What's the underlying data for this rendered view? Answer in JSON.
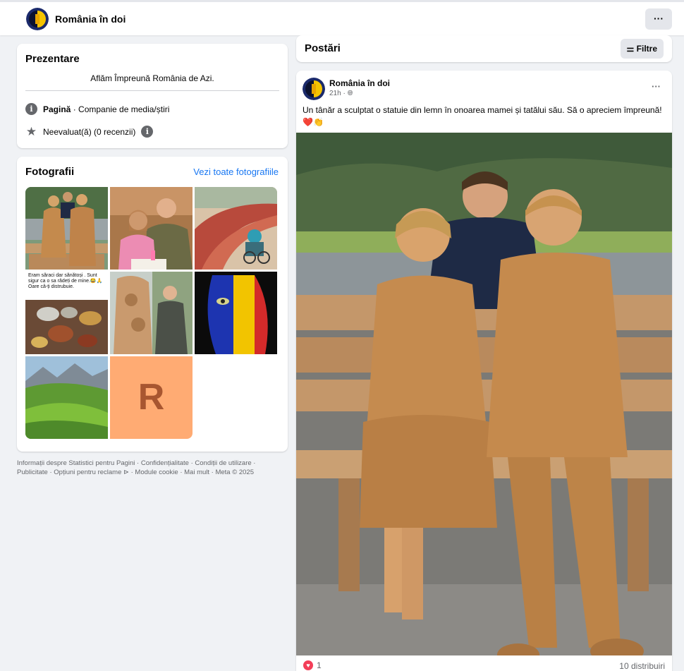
{
  "page": {
    "name": "România în doi",
    "more_label": "···"
  },
  "intro": {
    "title": "Prezentare",
    "bio": "Aflăm Împreună România de Azi.",
    "category_label": "Pagină",
    "category_value": " · Companie de media/știri",
    "rating": "Neevaluat(ă) (0 recenzii)",
    "info_icon": "info-icon",
    "star_icon": "star-icon"
  },
  "photos": {
    "title": "Fotografii",
    "see_all": "Vezi toate fotografiile",
    "tiles": [
      {
        "kind": "wooden-statues-family"
      },
      {
        "kind": "soldier-with-girl-cake"
      },
      {
        "kind": "procession-road"
      },
      {
        "kind": "meme-text-food",
        "caption": "Eram săraci dar  sănătoși . Sunt sigur ca o sa râdeți de mine.😂🙏 Oare câ-ți distrubuie."
      },
      {
        "kind": "wood-carving-man"
      },
      {
        "kind": "romanian-flag-face"
      },
      {
        "kind": "green-hills-mountains"
      },
      {
        "kind": "letter-avatar",
        "letter": "R",
        "color": "#ffab73",
        "text_color": "#a85630"
      }
    ]
  },
  "footer": {
    "line1": "Informații despre Statistici pentru Pagini · Confidențialitate · Condiții de utilizare ·",
    "line2": "Publicitate · Opțiuni pentru reclame ⊳ · Module cookie · Mai mult · Meta © 2025"
  },
  "posts": {
    "title": "Postări",
    "filter_label": "Filtre",
    "filter_icon": "sliders-icon"
  },
  "post": {
    "author": "România în doi",
    "time": "21h",
    "audience_icon": "globe-icon",
    "menu_label": "···",
    "text": "Un tânăr a sculptat o statuie din lemn în onoarea mamei și tatălui său. Să o apreciem împreună! ❤️👏",
    "reaction_count": "1",
    "reaction_icon": "love-icon",
    "shares": "10 distribuiri"
  },
  "colors": {
    "accent": "#1877f2",
    "background": "#f0f2f5",
    "love": "#f33e58",
    "avatar_bg": "#ffab73"
  }
}
